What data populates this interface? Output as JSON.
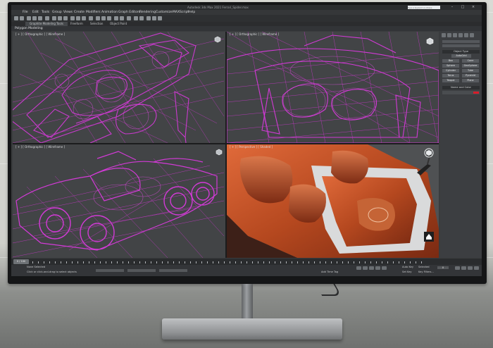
{
  "app": {
    "title": "Autodesk 3ds Max 2021  Ferrari_Spider.max",
    "search_placeholder": "Type a keyword or phrase"
  },
  "window_controls": [
    "–",
    "□",
    "×"
  ],
  "menu": [
    "File",
    "Edit",
    "Tools",
    "Group",
    "Views",
    "Create",
    "Modifiers",
    "Animation",
    "Graph Editors",
    "Rendering",
    "Customize",
    "MAXScript",
    "Help"
  ],
  "ribbon": {
    "tabs": [
      "Graphite Modeling Tools",
      "Freeform",
      "Selection",
      "Object Paint"
    ],
    "active_tab": "Graphite Modeling Tools",
    "panel_label": "Polygon Modeling"
  },
  "viewports": {
    "top_left_label": "[ + ] [ Orthographic ] [ Wireframe ]",
    "top_right_label": "[ + ] [ Orthographic ] [ Wireframe ]",
    "bottom_left_label": "[ + ] [ Orthographic ] [ Wireframe ]",
    "bottom_right_label": "[ + ] [ Perspective ] [ Shaded ]"
  },
  "command_panel": {
    "object_type_header": "Object Type",
    "autogrid_label": "AutoGrid",
    "buttons": [
      "Box",
      "Cone",
      "Sphere",
      "GeoSphere",
      "Cylinder",
      "Tube",
      "Torus",
      "Pyramid",
      "Teapot",
      "Plane"
    ],
    "name_color_header": "Name and Color",
    "object_color": "#d81c2a"
  },
  "timeline": {
    "frame_display": "0 / 100"
  },
  "status": {
    "selection_text": "None Selected",
    "prompt_text": "Click or click-and-drag to select objects",
    "add_time_tag": "Add Time Tag",
    "auto_key": "Auto Key",
    "set_key": "Set Key",
    "selected_dropdown": "Selected",
    "key_filters": "Key Filters...",
    "frame_field": "0"
  },
  "colors": {
    "wireframe": "#d23ad6",
    "shaded_body": "#c6532c",
    "viewport_bg": "#424446"
  }
}
